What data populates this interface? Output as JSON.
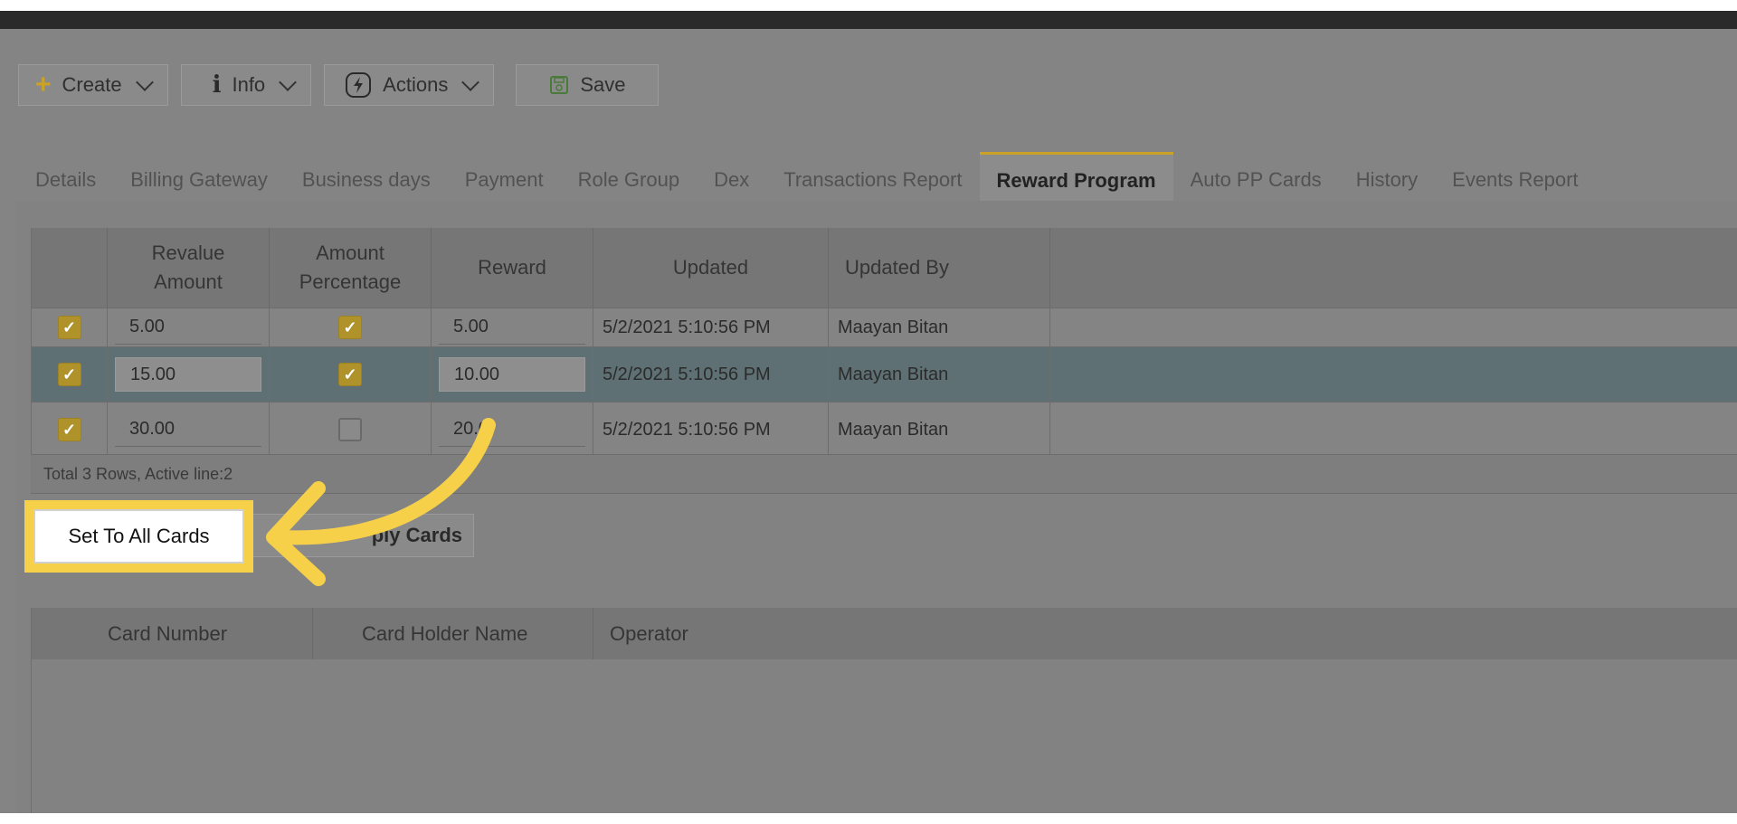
{
  "toolbar": {
    "create_label": "Create",
    "info_label": "Info",
    "actions_label": "Actions",
    "save_label": "Save"
  },
  "tabs": [
    "Details",
    "Billing Gateway",
    "Business days",
    "Payment",
    "Role Group",
    "Dex",
    "Transactions Report",
    "Reward Program",
    "Auto PP Cards",
    "History",
    "Events Report"
  ],
  "active_tab": "Reward Program",
  "reward_grid": {
    "headers": [
      "",
      "Revalue\nAmount",
      "Amount\nPercentage",
      "Reward",
      "Updated",
      "Updated By"
    ],
    "rows": [
      {
        "active": true,
        "revalue_amount": "5.00",
        "amount_percentage": true,
        "reward": "5.00",
        "updated": "5/2/2021 5:10:56 PM",
        "updated_by": "Maayan Bitan"
      },
      {
        "active": true,
        "revalue_amount": "15.00",
        "amount_percentage": true,
        "reward": "10.00",
        "updated": "5/2/2021 5:10:56 PM",
        "updated_by": "Maayan Bitan"
      },
      {
        "active": true,
        "revalue_amount": "30.00",
        "amount_percentage": false,
        "reward": "20.0",
        "updated": "5/2/2021 5:10:56 PM",
        "updated_by": "Maayan Bitan"
      }
    ],
    "footer": "Total 3 Rows, Active line:2"
  },
  "buttons": {
    "set_to_all_cards": "Set To All Cards",
    "apply_cards": "ply Cards"
  },
  "cards_grid": {
    "headers": [
      "Card Number",
      "Card Holder Name",
      "Operator"
    ]
  },
  "colors": {
    "accent": "#c9a227",
    "highlight": "#f7d04a",
    "selected_row": "#5e7074"
  }
}
